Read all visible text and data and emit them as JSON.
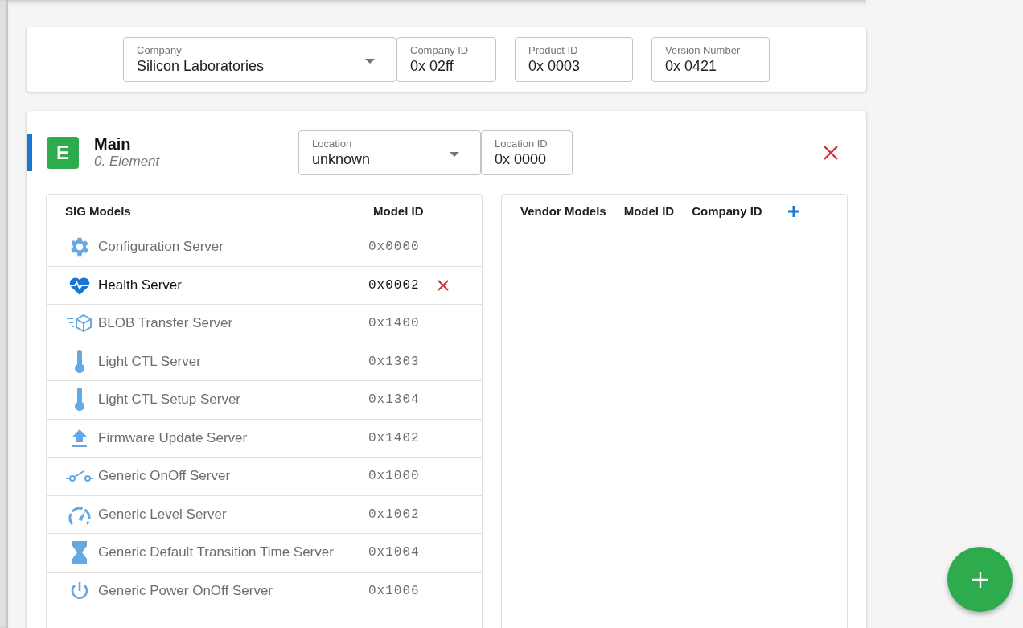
{
  "header_fields": [
    {
      "label": "Company",
      "value": "Silicon Laboratories",
      "kind": "select"
    },
    {
      "label": "Company ID",
      "value": "0x 02ff",
      "kind": "text"
    },
    {
      "label": "Product ID",
      "value": "0x 0003",
      "kind": "text"
    },
    {
      "label": "Version Number",
      "value": "0x 0421",
      "kind": "text"
    }
  ],
  "element": {
    "badge": "E",
    "title": "Main",
    "subtitle": "0. Element",
    "fields": [
      {
        "label": "Location",
        "value": "unknown",
        "kind": "select"
      },
      {
        "label": "Location ID",
        "value": "0x 0000",
        "kind": "text"
      }
    ]
  },
  "sig_models": {
    "columns": [
      "SIG Models",
      "Model ID"
    ],
    "rows": [
      {
        "name": "Configuration Server",
        "model_id": "0x0000",
        "selected": false
      },
      {
        "name": "Health Server",
        "model_id": "0x0002",
        "selected": true
      },
      {
        "name": "BLOB Transfer Server",
        "model_id": "0x1400",
        "selected": false
      },
      {
        "name": "Light CTL Server",
        "model_id": "0x1303",
        "selected": false
      },
      {
        "name": "Light CTL Setup Server",
        "model_id": "0x1304",
        "selected": false
      },
      {
        "name": "Firmware Update Server",
        "model_id": "0x1402",
        "selected": false
      },
      {
        "name": "Generic OnOff Server",
        "model_id": "0x1000",
        "selected": false
      },
      {
        "name": "Generic Level Server",
        "model_id": "0x1002",
        "selected": false
      },
      {
        "name": "Generic Default Transition Time Server",
        "model_id": "0x1004",
        "selected": false
      },
      {
        "name": "Generic Power OnOff Server",
        "model_id": "0x1006",
        "selected": false
      }
    ]
  },
  "vendor_models": {
    "columns": [
      "Vendor Models",
      "Model ID",
      "Company ID"
    ]
  }
}
